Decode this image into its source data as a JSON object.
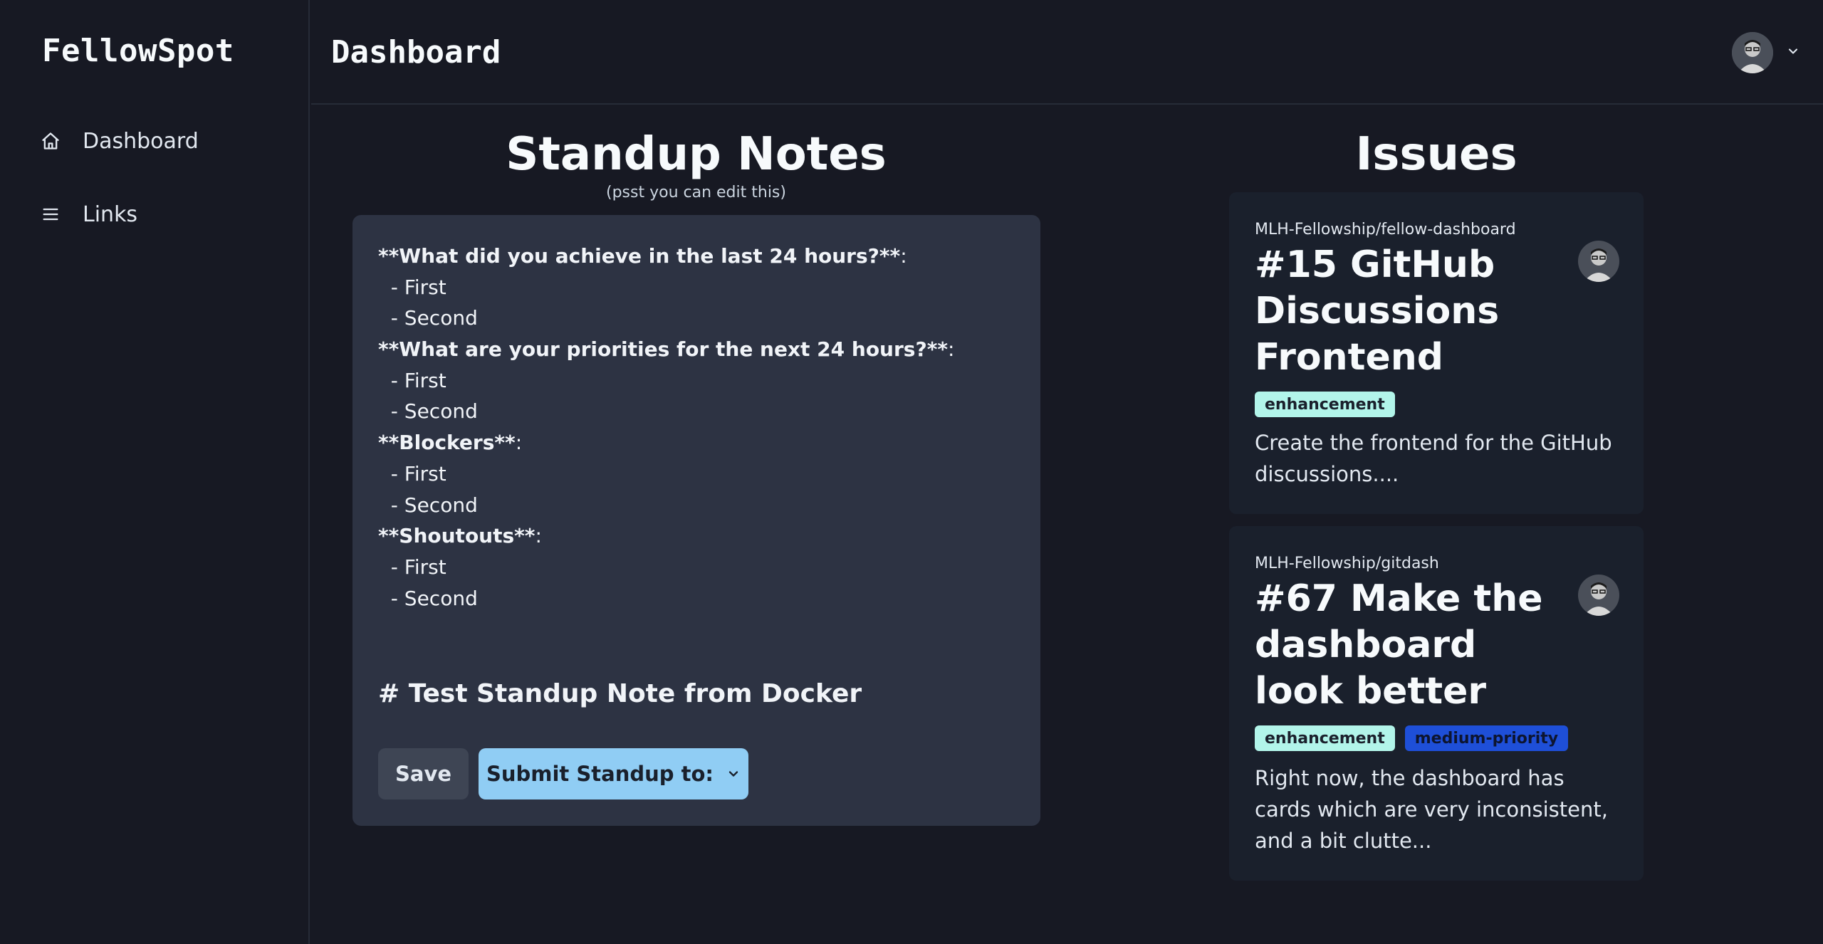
{
  "app": {
    "brand": "FellowSpot"
  },
  "sidebar": {
    "items": [
      {
        "label": "Dashboard",
        "icon": "home-icon"
      },
      {
        "label": "Links",
        "icon": "menu-icon"
      }
    ]
  },
  "header": {
    "title": "Dashboard"
  },
  "standup": {
    "title": "Standup Notes",
    "hint": "(psst you can edit this)",
    "lines": [
      {
        "text": "**What did you achieve in the last 24 hours?**",
        "suffix": ":",
        "bold": true
      },
      {
        "text": "  - First",
        "bold": false
      },
      {
        "text": "  - Second",
        "bold": false
      },
      {
        "text": "**What are your priorities for the next 24 hours?**",
        "suffix": ":",
        "bold": true
      },
      {
        "text": "  - First",
        "bold": false
      },
      {
        "text": "  - Second",
        "bold": false
      },
      {
        "text": "**Blockers**",
        "suffix": ":",
        "bold": true
      },
      {
        "text": "  - First",
        "bold": false
      },
      {
        "text": "  - Second",
        "bold": false
      },
      {
        "text": "**Shoutouts**",
        "suffix": ":",
        "bold": true
      },
      {
        "text": "  - First",
        "bold": false
      },
      {
        "text": "  - Second",
        "bold": false
      }
    ],
    "heading": "# Test Standup Note from Docker",
    "save_label": "Save",
    "submit_label": "Submit Standup to:"
  },
  "issues": {
    "title": "Issues",
    "cards": [
      {
        "repo": "MLH-Fellowship/fellow-dashboard",
        "title": "#15 GitHub Discussions Frontend",
        "tags": [
          {
            "label": "enhancement",
            "color": "#b2f5ea"
          }
        ],
        "description": "Create the frontend for the GitHub discussions...."
      },
      {
        "repo": "MLH-Fellowship/gitdash",
        "title": "#67 Make the dashboard look better",
        "tags": [
          {
            "label": "enhancement",
            "color": "#b2f5ea"
          },
          {
            "label": "medium-priority",
            "color": "#1e4fd8"
          }
        ],
        "description": "Right now, the dashboard has cards which are very inconsistent, and a bit clutte..."
      }
    ]
  },
  "colors": {
    "background": "#171923",
    "card": "#2d3343",
    "issue_card": "#1a202c",
    "accent": "#90cdf4"
  }
}
